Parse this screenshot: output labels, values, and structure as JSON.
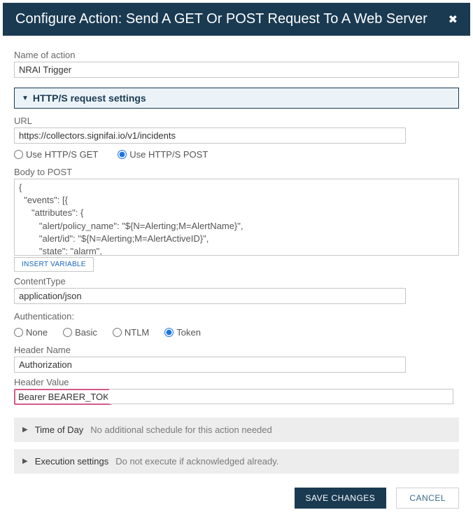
{
  "dialog": {
    "title": "Configure Action: Send A GET Or POST Request To A Web Server"
  },
  "nameOfAction": {
    "label": "Name of action",
    "value": "NRAI Trigger"
  },
  "sectionHeader": "HTTP/S request settings",
  "url": {
    "label": "URL",
    "value": "https://collectors.signifai.io/v1/incidents"
  },
  "method": {
    "options": {
      "get": "Use HTTP/S GET",
      "post": "Use HTTP/S POST"
    },
    "selected": "post"
  },
  "body": {
    "label": "Body to POST",
    "value": "{\n  \"events\": [{\n     \"attributes\": {\n        \"alert/policy_name\": \"${N=Alerting;M=AlertName}\",\n        \"alert/id\": \"${N=Alerting;M=AlertActiveID}\",\n        \"state\": \"alarm\","
  },
  "insertVariable": "INSERT VARIABLE",
  "contentType": {
    "label": "ContentType",
    "value": "application/json"
  },
  "auth": {
    "label": "Authentication:",
    "options": {
      "none": "None",
      "basic": "Basic",
      "ntlm": "NTLM",
      "token": "Token"
    },
    "selected": "token"
  },
  "headerName": {
    "label": "Header Name",
    "value": "Authorization"
  },
  "headerValue": {
    "label": "Header Value",
    "value": "Bearer BEARER_TOKEN"
  },
  "timeOfDay": {
    "title": "Time of Day",
    "sub": "No additional schedule for this action needed"
  },
  "execution": {
    "title": "Execution settings",
    "sub": "Do not execute if acknowledged already."
  },
  "footer": {
    "save": "SAVE CHANGES",
    "cancel": "CANCEL"
  }
}
